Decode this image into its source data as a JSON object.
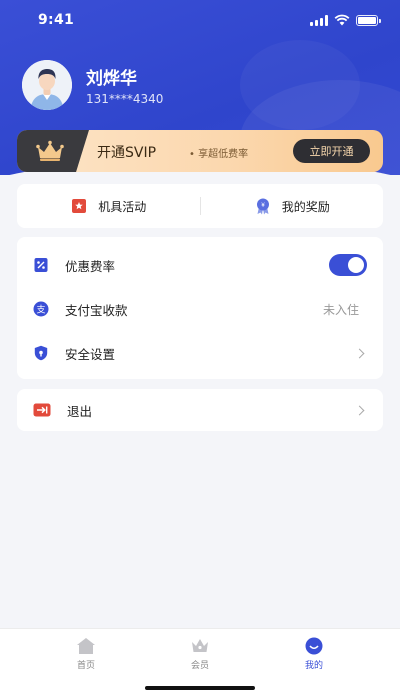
{
  "status_bar": {
    "time": "9:41"
  },
  "profile": {
    "name": "刘烨华",
    "phone": "131****4340"
  },
  "vip_banner": {
    "title": "开通SVIP",
    "subtitle": "• 享超低费率",
    "button_label": "立即开通"
  },
  "quick_actions": [
    {
      "label": "机具活动",
      "icon": "red-bookmark-star-icon"
    },
    {
      "label": "我的奖励",
      "icon": "award-ribbon-icon"
    }
  ],
  "menu": [
    {
      "label": "优惠费率",
      "icon": "percent-coupon-icon",
      "control": "toggle",
      "toggle_on": true
    },
    {
      "label": "支付宝收款",
      "icon": "alipay-icon",
      "value": "未入住"
    },
    {
      "label": "安全设置",
      "icon": "shield-icon",
      "control": "chevron"
    }
  ],
  "logout": {
    "label": "退出",
    "icon": "exit-arrow-icon"
  },
  "bottom_nav": [
    {
      "label": "首页",
      "icon": "home-icon",
      "active": false
    },
    {
      "label": "会员",
      "icon": "crown-icon",
      "active": false
    },
    {
      "label": "我的",
      "icon": "smile-icon",
      "active": true
    }
  ],
  "colors": {
    "primary": "#3a4fd6",
    "vip_dark": "#3a3a3e",
    "vip_gold": "#fbd7ad",
    "accent_red": "#e24a3b"
  }
}
